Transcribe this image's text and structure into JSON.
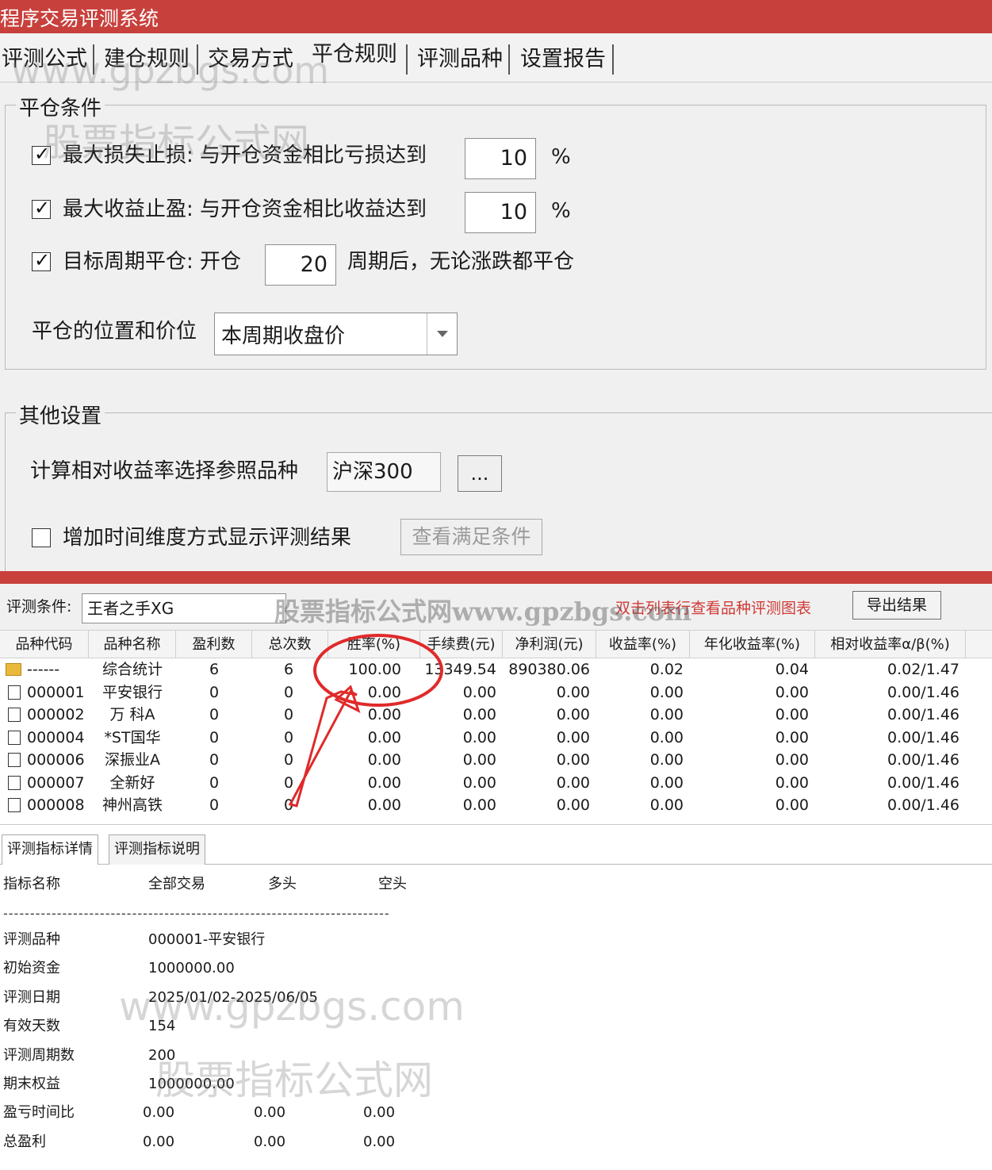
{
  "window": {
    "title": "程序交易评测系统"
  },
  "tabs": [
    {
      "label": "评测公式"
    },
    {
      "label": "建仓规则"
    },
    {
      "label": "交易方式"
    },
    {
      "label": "平仓规则"
    },
    {
      "label": "评测品种"
    },
    {
      "label": "设置报告"
    }
  ],
  "close_conditions": {
    "title": "平仓条件",
    "stop_loss": {
      "checked": true,
      "label": "最大损失止损: 与开仓资金相比亏损达到",
      "value": "10",
      "unit": "%"
    },
    "take_profit": {
      "checked": true,
      "label": "最大收益止盈: 与开仓资金相比收益达到",
      "value": "10",
      "unit": "%"
    },
    "target_period": {
      "checked": true,
      "label": "目标周期平仓: 开仓",
      "value": "20",
      "suffix": "周期后，无论涨跌都平仓"
    },
    "position_price": {
      "label": "平仓的位置和价位",
      "selected": "本周期收盘价"
    }
  },
  "other_settings": {
    "title": "其他设置",
    "reference_label": "计算相对收益率选择参照品种",
    "reference_value": "沪深300",
    "browse_label": "...",
    "time_dimension": {
      "checked": false,
      "label": "增加时间维度方式显示评测结果"
    },
    "view_conditions_label": "查看满足条件"
  },
  "results": {
    "condition_label": "评测条件:",
    "condition_value": "王者之手XG",
    "hint": "双击列表行查看品种评测图表",
    "export_label": "导出结果",
    "columns": [
      "品种代码",
      "品种名称",
      "盈利数",
      "总次数",
      "胜率(%)",
      "手续费(元)",
      "净利润(元)",
      "收益率(%)",
      "年化收益率(%)",
      "相对收益率α/β(%)"
    ],
    "rows": [
      {
        "code": "------",
        "name": "综合统计",
        "wins": "6",
        "total": "6",
        "winrate": "100.00",
        "fee": "13349.54",
        "net": "890380.06",
        "ret": "0.02",
        "annual": "0.04",
        "relative": "0.02/1.47",
        "folder": true
      },
      {
        "code": "000001",
        "name": "平安银行",
        "wins": "0",
        "total": "0",
        "winrate": "0.00",
        "fee": "0.00",
        "net": "0.00",
        "ret": "0.00",
        "annual": "0.00",
        "relative": "0.00/1.46"
      },
      {
        "code": "000002",
        "name": "万 科A",
        "wins": "0",
        "total": "0",
        "winrate": "0.00",
        "fee": "0.00",
        "net": "0.00",
        "ret": "0.00",
        "annual": "0.00",
        "relative": "0.00/1.46"
      },
      {
        "code": "000004",
        "name": "*ST国华",
        "wins": "0",
        "total": "0",
        "winrate": "0.00",
        "fee": "0.00",
        "net": "0.00",
        "ret": "0.00",
        "annual": "0.00",
        "relative": "0.00/1.46"
      },
      {
        "code": "000006",
        "name": "深振业A",
        "wins": "0",
        "total": "0",
        "winrate": "0.00",
        "fee": "0.00",
        "net": "0.00",
        "ret": "0.00",
        "annual": "0.00",
        "relative": "0.00/1.46"
      },
      {
        "code": "000007",
        "name": "全新好",
        "wins": "0",
        "total": "0",
        "winrate": "0.00",
        "fee": "0.00",
        "net": "0.00",
        "ret": "0.00",
        "annual": "0.00",
        "relative": "0.00/1.46"
      },
      {
        "code": "000008",
        "name": "神州高铁",
        "wins": "0",
        "total": "0",
        "winrate": "0.00",
        "fee": "0.00",
        "net": "0.00",
        "ret": "0.00",
        "annual": "0.00",
        "relative": "0.00/1.46"
      }
    ]
  },
  "detail_tabs": [
    {
      "label": "评测指标详情"
    },
    {
      "label": "评测指标说明"
    }
  ],
  "details": {
    "headers": [
      "指标名称",
      "全部交易",
      "多头",
      "空头"
    ],
    "separator": "------------------------------------------------------------------------",
    "items": [
      {
        "label": "评测品种",
        "values": [
          "000001-平安银行"
        ]
      },
      {
        "label": "初始资金",
        "values": [
          "1000000.00"
        ]
      },
      {
        "label": "评测日期",
        "values": [
          "2025/01/02-2025/06/05"
        ]
      },
      {
        "label": "有效天数",
        "values": [
          "154"
        ]
      },
      {
        "label": "评测周期数",
        "values": [
          "200"
        ]
      },
      {
        "label": "期末权益",
        "values": [
          "1000000.00"
        ]
      },
      {
        "label": "盈亏时间比",
        "values": [
          "0.00",
          "0.00",
          "0.00"
        ]
      },
      {
        "label": "总盈利",
        "values": [
          "0.00",
          "0.00",
          "0.00"
        ]
      }
    ]
  },
  "watermarks": {
    "site_url": "www.gpzbgs.com",
    "site_name": "股票指标公式网",
    "mixed": "股票指标公式网www.gpzbgs.com"
  },
  "colors": {
    "titlebar": "#c8403c",
    "hint_text": "#d03a36",
    "annotation": "#e02a2a",
    "folder_icon": "#e9b93b"
  },
  "icons": {
    "dropdown": "chevron-down-icon",
    "checkbox_checked": "checkmark-icon",
    "row": "document-icon",
    "summary_row": "folder-icon"
  }
}
